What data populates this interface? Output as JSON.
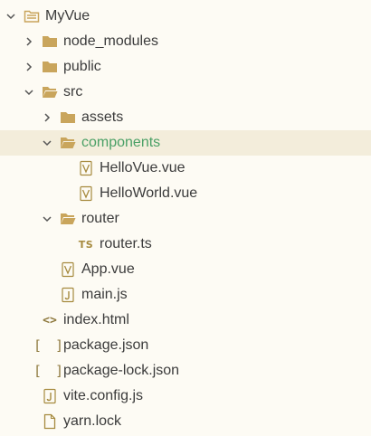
{
  "colors": {
    "background": "#fdfbf4",
    "selected_row": "#f3eddb",
    "folder": "#c9a55c",
    "active_label": "#4aa066",
    "file_glyph": "#a68a3e"
  },
  "tree": {
    "root": {
      "label": "MyVue",
      "icon": "folder-root-icon"
    },
    "node_modules": {
      "label": "node_modules",
      "icon": "folder-icon"
    },
    "public": {
      "label": "public",
      "icon": "folder-icon"
    },
    "src": {
      "label": "src",
      "icon": "folder-open-icon"
    },
    "assets": {
      "label": "assets",
      "icon": "folder-icon"
    },
    "components": {
      "label": "components",
      "icon": "folder-open-icon",
      "selected": true
    },
    "hellovue": {
      "label": "HelloVue.vue",
      "icon": "vue-file-icon"
    },
    "helloworld": {
      "label": "HelloWorld.vue",
      "icon": "vue-file-icon"
    },
    "router": {
      "label": "router",
      "icon": "folder-open-icon"
    },
    "router_ts": {
      "label": "router.ts",
      "icon": "ts-file-icon",
      "glyph": "TS"
    },
    "app_vue": {
      "label": "App.vue",
      "icon": "vue-file-icon"
    },
    "main_js": {
      "label": "main.js",
      "icon": "js-file-icon"
    },
    "index_html": {
      "label": "index.html",
      "icon": "html-file-icon",
      "glyph": "<>"
    },
    "package_json": {
      "label": "package.json",
      "icon": "json-file-icon",
      "glyph": "[ ]"
    },
    "package_lock": {
      "label": "package-lock.json",
      "icon": "json-file-icon",
      "glyph": "[ ]"
    },
    "vite_config": {
      "label": "vite.config.js",
      "icon": "js-file-icon"
    },
    "yarn_lock": {
      "label": "yarn.lock",
      "icon": "file-icon"
    }
  }
}
